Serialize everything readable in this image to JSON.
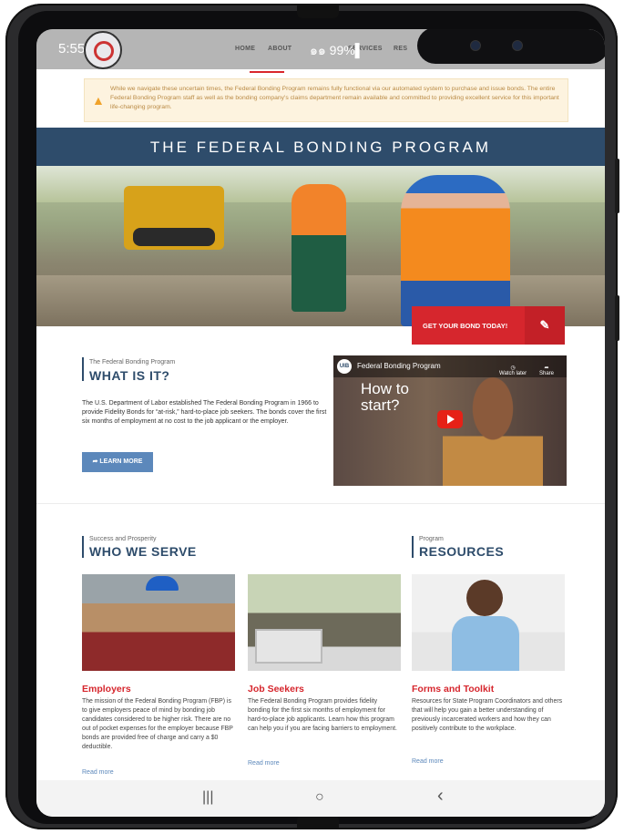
{
  "status_bar": {
    "time": "5:55 PM",
    "signal": "๑๑ 99%▌"
  },
  "nav": {
    "items": [
      "HOME",
      "ABOUT",
      "SERVICES",
      "RES"
    ]
  },
  "alert": {
    "text": "While we navigate these uncertain times, the Federal Bonding Program remains fully functional via our automated system to purchase and issue bonds. The entire Federal Bonding Program staff as well as the bonding company's claims department remain available and committed to providing excellent service for this important life-changing program."
  },
  "banner": {
    "title": "THE FEDERAL BONDING PROGRAM"
  },
  "cta": {
    "label": "GET YOUR BOND TODAY!"
  },
  "what_is_it": {
    "kicker": "The Federal Bonding Program",
    "title": "WHAT IS IT?",
    "text": "The U.S. Department of Labor established The Federal Bonding Program in 1966 to provide Fidelity Bonds for “at-risk,” hard-to-place job seekers. The bonds cover the first six months of employment at no cost to the job applicant or the employer.",
    "button": "LEARN MORE"
  },
  "video": {
    "logo": "UIB",
    "title": "Federal Bonding Program",
    "watch_later": "Watch later",
    "share": "Share",
    "heading_line1": "How to",
    "heading_line2": "start?"
  },
  "who_we_serve": {
    "kicker": "Success and Prosperity",
    "title": "WHO WE SERVE"
  },
  "resources": {
    "kicker": "Program",
    "title": "RESOURCES"
  },
  "cards": [
    {
      "title": "Employers",
      "text": "The mission of the Federal Bonding Program (FBP) is to give employers peace of mind by bonding job candidates considered to be higher risk. There are no out of pocket expenses for the employer because FBP bonds are provided free of charge and carry a $0 deductible.",
      "link": "Read more"
    },
    {
      "title": "Job Seekers",
      "text": "The Federal Bonding Program provides fidelity bonding for the first six months of employment for hard-to-place job applicants. Learn how this program can help you if you are facing barriers to employment.",
      "link": "Read more"
    },
    {
      "title": "Forms and Toolkit",
      "text": "Resources for State Program Coordinators and others that will help you gain a better understanding of previously incarcerated workers and how they can positively contribute to the workplace.",
      "link": "Read more"
    }
  ],
  "system_nav": {
    "recents": "|||",
    "home": "○",
    "back": "‹"
  }
}
